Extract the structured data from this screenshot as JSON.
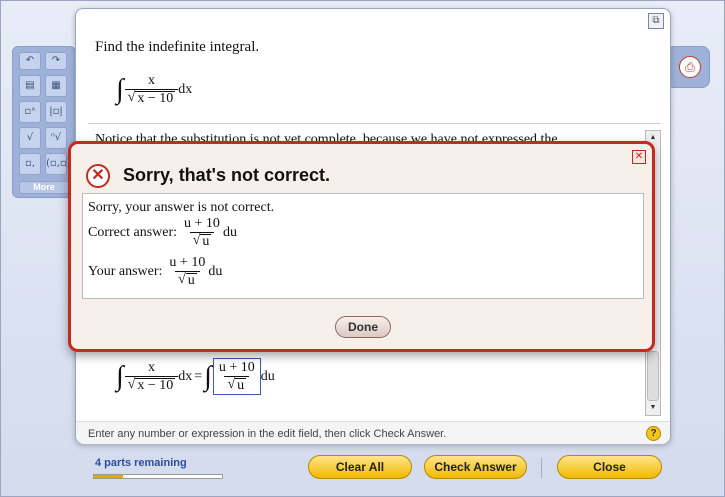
{
  "problem": {
    "title": "Find the indefinite integral.",
    "integrand_numerator": "x",
    "integrand_radicand": "x − 10",
    "differential": "dx",
    "notice": "Notice that the substitution is not yet complete, because we have not expressed the"
  },
  "work_line": {
    "lhs_numerator": "x",
    "lhs_radicand": "x − 10",
    "lhs_differential": "dx",
    "equals": "=",
    "answer_numerator": "u + 10",
    "answer_radicand": "u",
    "answer_differential": "du"
  },
  "feedback": {
    "title": "Sorry, that's not correct.",
    "line1": "Sorry, your answer is not correct.",
    "correct_label": "Correct answer:",
    "correct_numerator": "u + 10",
    "correct_radicand": "u",
    "correct_differential": "du",
    "your_label": "Your answer:",
    "your_numerator": "u + 10",
    "your_radicand": "u",
    "your_differential": "du",
    "done_label": "Done"
  },
  "palette": {
    "more_label": "More"
  },
  "footer": {
    "instruction": "Enter any number or expression in the edit field, then click Check Answer.",
    "help_glyph": "?"
  },
  "bottom_bar": {
    "parts_remaining": "4 parts remaining",
    "progress_fraction": 0.23,
    "clear_all": "Clear All",
    "check_answer": "Check Answer",
    "close": "Close"
  },
  "icons": {
    "sqrt_glyph": "√",
    "integral_glyph": "∫"
  },
  "colors": {
    "error_red": "#c62a1b",
    "button_yellow": "#f2b900",
    "progress_orange": "#f0a400"
  }
}
